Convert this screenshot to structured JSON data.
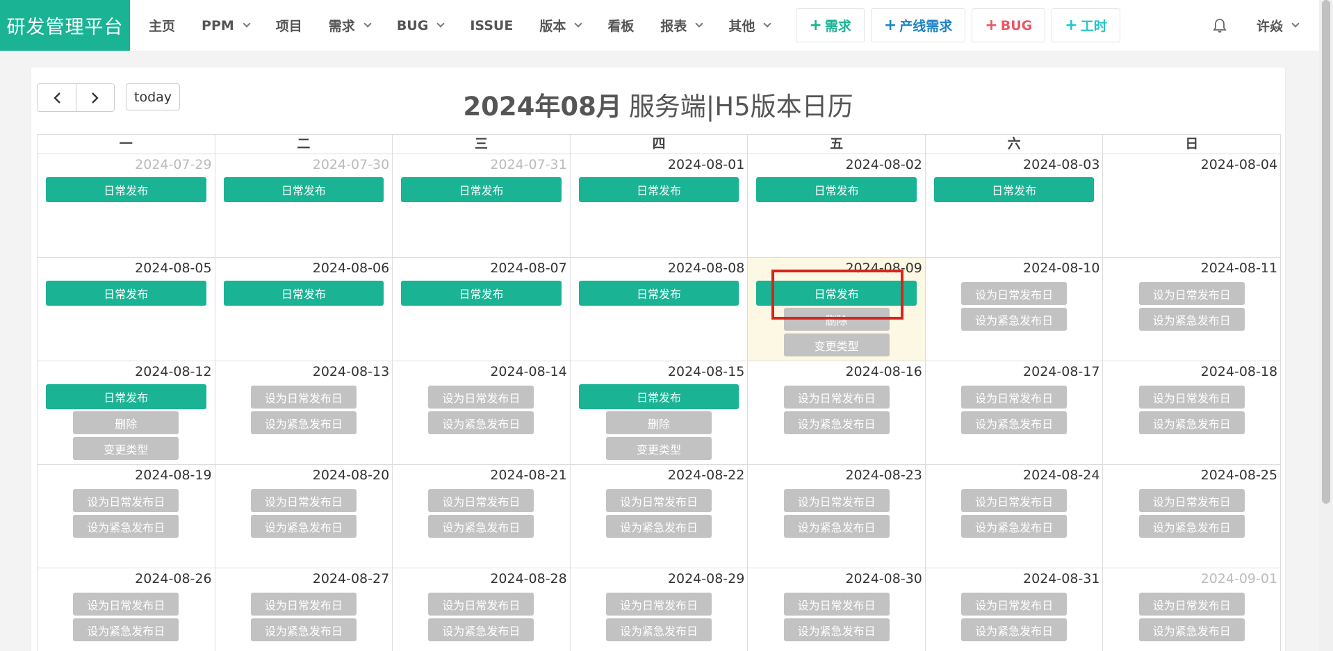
{
  "navbar": {
    "brand": "研发管理平台",
    "menu": [
      {
        "label": "主页",
        "dropdown": false
      },
      {
        "label": "PPM",
        "dropdown": true
      },
      {
        "label": "项目",
        "dropdown": false
      },
      {
        "label": "需求",
        "dropdown": true
      },
      {
        "label": "BUG",
        "dropdown": true
      },
      {
        "label": "ISSUE",
        "dropdown": false
      },
      {
        "label": "版本",
        "dropdown": true
      },
      {
        "label": "看板",
        "dropdown": false
      },
      {
        "label": "报表",
        "dropdown": true
      },
      {
        "label": "其他",
        "dropdown": true
      }
    ],
    "quick_buttons": [
      {
        "plus": "+",
        "label": "需求",
        "color": "#1ab394"
      },
      {
        "plus": "+",
        "label": "产线需求",
        "color": "#1c84c6"
      },
      {
        "plus": "+",
        "label": "BUG",
        "color": "#ed5565"
      },
      {
        "plus": "+",
        "label": "工时",
        "color": "#23c6c8"
      }
    ],
    "user": "许焱",
    "bell_icon": "bell-icon"
  },
  "calendar": {
    "today_label": "today",
    "title_bold": "2024年08月",
    "title_rest": "服务端|H5版本日历",
    "weekdays": [
      "一",
      "二",
      "三",
      "四",
      "五",
      "六",
      "日"
    ],
    "labels": {
      "event": "日常发布",
      "set_daily": "设为日常发布日",
      "set_urgent": "设为紧急发布日",
      "delete": "删除",
      "change_type": "变更类型"
    },
    "weeks": [
      [
        {
          "date": "2024-07-29",
          "other": true,
          "event": true
        },
        {
          "date": "2024-07-30",
          "other": true,
          "event": true
        },
        {
          "date": "2024-07-31",
          "other": true,
          "event": true
        },
        {
          "date": "2024-08-01",
          "event": true
        },
        {
          "date": "2024-08-02",
          "event": true
        },
        {
          "date": "2024-08-03",
          "event": true
        },
        {
          "date": "2024-08-04"
        }
      ],
      [
        {
          "date": "2024-08-05",
          "event": true
        },
        {
          "date": "2024-08-06",
          "event": true
        },
        {
          "date": "2024-08-07",
          "event": true
        },
        {
          "date": "2024-08-08",
          "event": true
        },
        {
          "date": "2024-08-09",
          "event": true,
          "today": true,
          "actions": true
        },
        {
          "date": "2024-08-10",
          "setters": true
        },
        {
          "date": "2024-08-11",
          "setters": true
        }
      ],
      [
        {
          "date": "2024-08-12",
          "event": true,
          "actions": true
        },
        {
          "date": "2024-08-13",
          "setters": true
        },
        {
          "date": "2024-08-14",
          "setters": true
        },
        {
          "date": "2024-08-15",
          "event": true,
          "actions": true
        },
        {
          "date": "2024-08-16",
          "setters": true
        },
        {
          "date": "2024-08-17",
          "setters": true
        },
        {
          "date": "2024-08-18",
          "setters": true
        }
      ],
      [
        {
          "date": "2024-08-19",
          "setters": true
        },
        {
          "date": "2024-08-20",
          "setters": true
        },
        {
          "date": "2024-08-21",
          "setters": true
        },
        {
          "date": "2024-08-22",
          "setters": true
        },
        {
          "date": "2024-08-23",
          "setters": true
        },
        {
          "date": "2024-08-24",
          "setters": true
        },
        {
          "date": "2024-08-25",
          "setters": true
        }
      ],
      [
        {
          "date": "2024-08-26",
          "setters": true
        },
        {
          "date": "2024-08-27",
          "setters": true
        },
        {
          "date": "2024-08-28",
          "setters": true
        },
        {
          "date": "2024-08-29",
          "setters": true
        },
        {
          "date": "2024-08-30",
          "setters": true
        },
        {
          "date": "2024-08-31",
          "setters": true
        },
        {
          "date": "2024-09-01",
          "other": true,
          "setters": true
        }
      ]
    ]
  }
}
